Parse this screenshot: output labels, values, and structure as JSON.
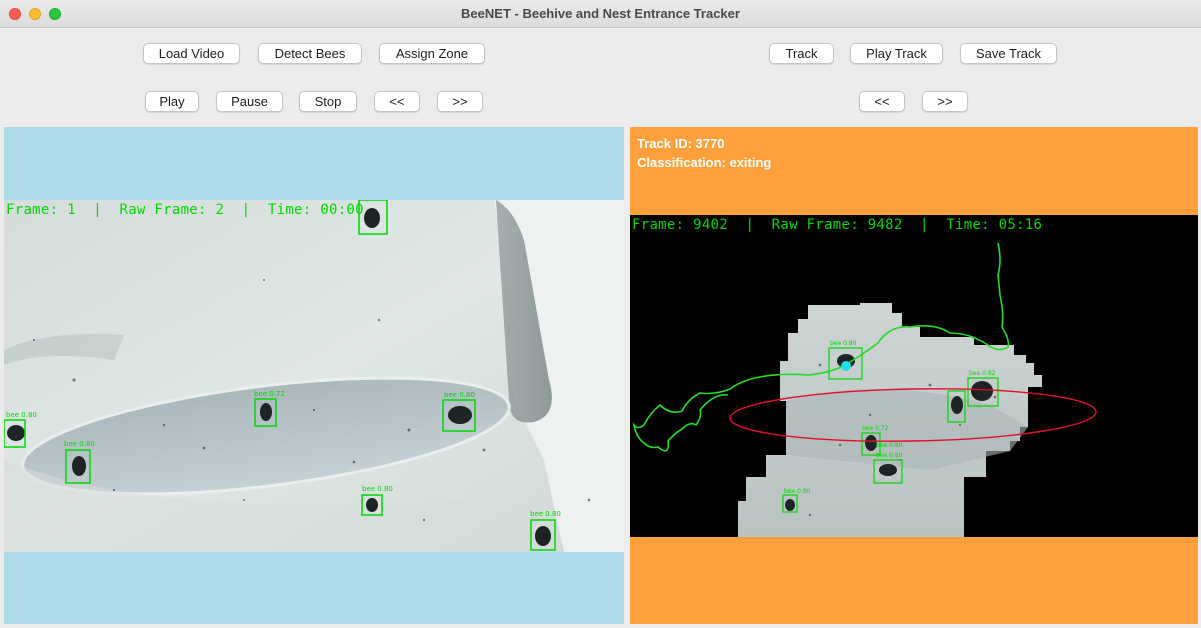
{
  "window": {
    "title": "BeeNET - Beehive and Nest Entrance Tracker"
  },
  "toolbar": {
    "load_video": "Load Video",
    "detect_bees": "Detect Bees",
    "assign_zone": "Assign Zone",
    "play": "Play",
    "pause": "Pause",
    "stop": "Stop",
    "prev": "<<",
    "next": ">>",
    "track": "Track",
    "play_track": "Play Track",
    "save_track": "Save Track",
    "track_prev": "<<",
    "track_next": ">>"
  },
  "left_view": {
    "frame_info": "Frame: 1  |  Raw Frame: 2  |  Time: 00:00",
    "detections": [
      "bee 0.80",
      "bee 0.80",
      "bee 0.72",
      "bee 0.80",
      "bee 0.80",
      "bee 0.80"
    ]
  },
  "right_view": {
    "track_id": "Track ID: 3770",
    "classification": "Classification: exiting",
    "frame_info": "Frame: 9402  |  Raw Frame: 9482  |  Time: 05:16",
    "detections": [
      "bee 0.80",
      "bee 0.82",
      "bee 0.72",
      "bee 0.80",
      "bee 0.80",
      "bee 0.80"
    ]
  },
  "colors": {
    "left_panel_bg": "#add8e6",
    "right_panel_bg": "#ffa03c",
    "detection_box": "#00d800",
    "track_path": "#22dd22",
    "zone_ellipse": "#e0102a",
    "track_point": "#22e0f0"
  }
}
